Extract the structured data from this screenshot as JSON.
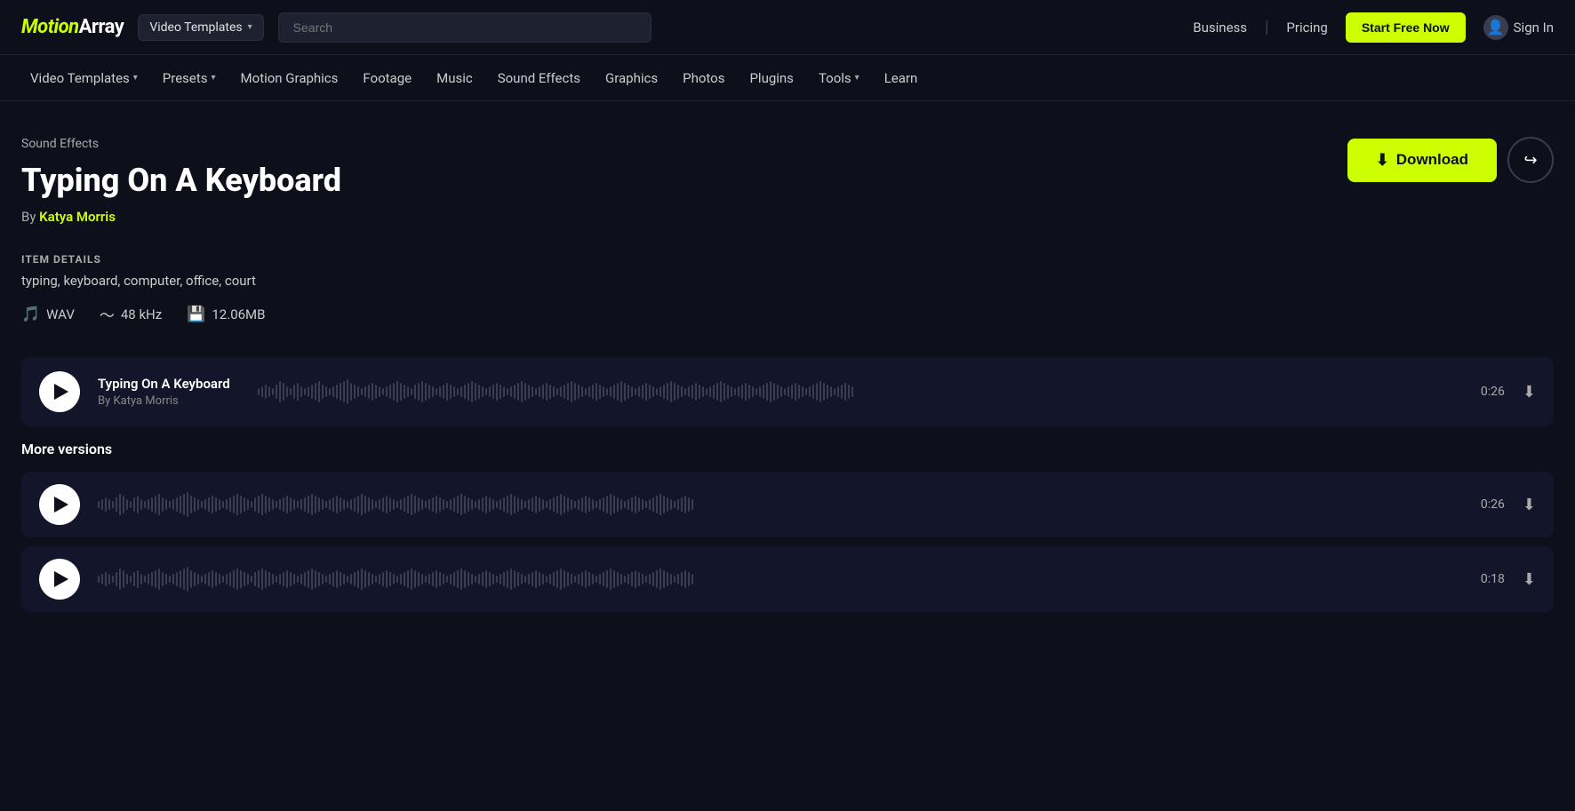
{
  "logo": {
    "prefix": "Motion",
    "suffix": "Array"
  },
  "topNav": {
    "videoTemplatesDropdown": "Video Templates",
    "searchPlaceholder": "Search",
    "businessLabel": "Business",
    "pricingLabel": "Pricing",
    "startFreeLabel": "Start Free Now",
    "signInLabel": "Sign In"
  },
  "secondaryNav": {
    "items": [
      {
        "label": "Video Templates",
        "hasDropdown": true
      },
      {
        "label": "Presets",
        "hasDropdown": true
      },
      {
        "label": "Motion Graphics",
        "hasDropdown": false
      },
      {
        "label": "Footage",
        "hasDropdown": false
      },
      {
        "label": "Music",
        "hasDropdown": false
      },
      {
        "label": "Sound Effects",
        "hasDropdown": false
      },
      {
        "label": "Graphics",
        "hasDropdown": false
      },
      {
        "label": "Photos",
        "hasDropdown": false
      },
      {
        "label": "Plugins",
        "hasDropdown": false
      },
      {
        "label": "Tools",
        "hasDropdown": true
      },
      {
        "label": "Learn",
        "hasDropdown": false
      }
    ]
  },
  "breadcrumb": "Sound Effects",
  "pageTitle": "Typing On A Keyboard",
  "author": {
    "prefix": "By ",
    "name": "Katya Morris"
  },
  "downloadButton": "Download",
  "itemDetails": {
    "label": "ITEM DETAILS",
    "tags": "typing, keyboard, computer, office, court",
    "format": "WAV",
    "sampleRate": "48 kHz",
    "fileSize": "12.06MB"
  },
  "mainPlayer": {
    "trackTitle": "Typing On A Keyboard",
    "trackAuthor": "By Katya Morris",
    "duration": "0:26"
  },
  "moreVersions": {
    "label": "More versions",
    "versions": [
      {
        "duration": "0:26"
      },
      {
        "duration": "0:18"
      }
    ]
  },
  "waveformBars": [
    2,
    3,
    4,
    3,
    2,
    4,
    6,
    5,
    3,
    2,
    4,
    5,
    3,
    2,
    3,
    4,
    5,
    6,
    4,
    3,
    2,
    3,
    4,
    5,
    6,
    7,
    5,
    4,
    3,
    2,
    3,
    4,
    5,
    4,
    3,
    2,
    3,
    4,
    5,
    6,
    5,
    4,
    3,
    2,
    4,
    5,
    6,
    5,
    4,
    3,
    2,
    3,
    4,
    5,
    4,
    3,
    2,
    3,
    4,
    5,
    6,
    5,
    4,
    3,
    2,
    3,
    4,
    5,
    4,
    3,
    2,
    3,
    4,
    5,
    6,
    5,
    4,
    3,
    2,
    3,
    4,
    5,
    4,
    3,
    2,
    3,
    4,
    5,
    6,
    5,
    4,
    3,
    2,
    3,
    4,
    5,
    4,
    3,
    2,
    3,
    4,
    5,
    6,
    5,
    4,
    3,
    2,
    3,
    4,
    5,
    4,
    3,
    2,
    3,
    4,
    5,
    6,
    5,
    4,
    3,
    2,
    3,
    4,
    5,
    4,
    3,
    2,
    3,
    4,
    5,
    6,
    5,
    4,
    3,
    2,
    3,
    4,
    5,
    4,
    3,
    2,
    3,
    4,
    5,
    6,
    5,
    4,
    3,
    2,
    3,
    4,
    5,
    4,
    3,
    2,
    3,
    4,
    5,
    6,
    5,
    4,
    3,
    2,
    3,
    4,
    5,
    4,
    3
  ]
}
